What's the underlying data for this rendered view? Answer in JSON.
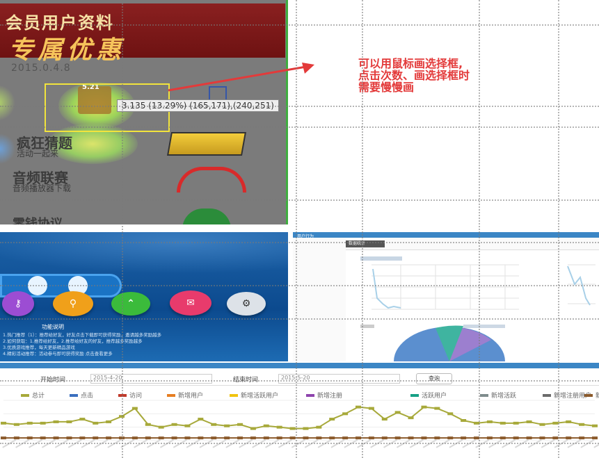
{
  "heatmap": {
    "banner_line1": "会员用户资料",
    "banner_line2": "专属优惠",
    "date": "2015.0.4.8",
    "tooltip": "3.135 (13.29%) (165,171),(240,251)",
    "rows": [
      "疯狂猜题",
      "活动一起来",
      "音频联赛",
      "音频播放器下载",
      "零钱协议"
    ],
    "icon_text": "5.21"
  },
  "annotation": {
    "line1": "可以用鼠标画选择框,",
    "line2": "点击次数、画选择框时",
    "line3": "需要慢慢画"
  },
  "app_panel": {
    "buttons": [
      "",
      "",
      "",
      "",
      ""
    ],
    "title": "功能说明",
    "lines": [
      "1.热门推荐（1）：推荐给好友，好友点击下载即可获得奖励，邀请越多奖励越多",
      "2.如何获取：1.推荐给好友，2.推荐给好友的好友，推荐越多奖励越多",
      "3.优质游戏推荐，每天更新精品游戏",
      "4.精彩活动推荐：活动参与即可获得奖励 点击查看更多"
    ]
  },
  "dashboard": {
    "tab": "用户行为",
    "button": "数据统计"
  },
  "bottom_chart": {
    "field1_label": "开始时间",
    "field1_value": "2015-4-20",
    "field2_label": "结束时间",
    "field2_value": "2015-5-20",
    "query_button": "查询",
    "legend": [
      "总计",
      "点击",
      "访问",
      "新增用户",
      "新增活跃用户",
      "新增注册",
      "活跃用户",
      "新增活跃",
      "新增注册用户",
      "新增"
    ]
  },
  "colors": {
    "annotation": "#e33a3a",
    "selection": "#f2e43c",
    "heatmap_bg": "#7b7b7b",
    "app_blue": "#0c4a8e",
    "series_olive": "#a7a93a",
    "series_brown": "#8b5a2b",
    "dash_blue": "#3b86c5"
  },
  "chart_data": {
    "type": "line",
    "series": [
      {
        "values": [
          13,
          12,
          13,
          13,
          14,
          14,
          16,
          13,
          14,
          18,
          24,
          12,
          10,
          12,
          11,
          16,
          12,
          11,
          12,
          9,
          11,
          10,
          9,
          9,
          10,
          16,
          20,
          25,
          24,
          16,
          21,
          17,
          25,
          24,
          20,
          15,
          13,
          14,
          13,
          13,
          14,
          12,
          13,
          14,
          12,
          11
        ]
      },
      {
        "values": [
          2,
          2,
          2,
          2,
          2,
          2,
          2,
          2,
          2,
          2,
          2,
          2,
          2,
          2,
          2,
          2,
          2,
          2,
          2,
          2,
          2,
          2,
          2,
          2,
          2,
          2,
          2,
          2,
          2,
          2,
          2,
          2,
          2,
          2,
          2,
          2,
          2,
          2,
          2,
          2,
          2,
          2,
          2,
          2,
          2,
          2
        ]
      }
    ]
  }
}
